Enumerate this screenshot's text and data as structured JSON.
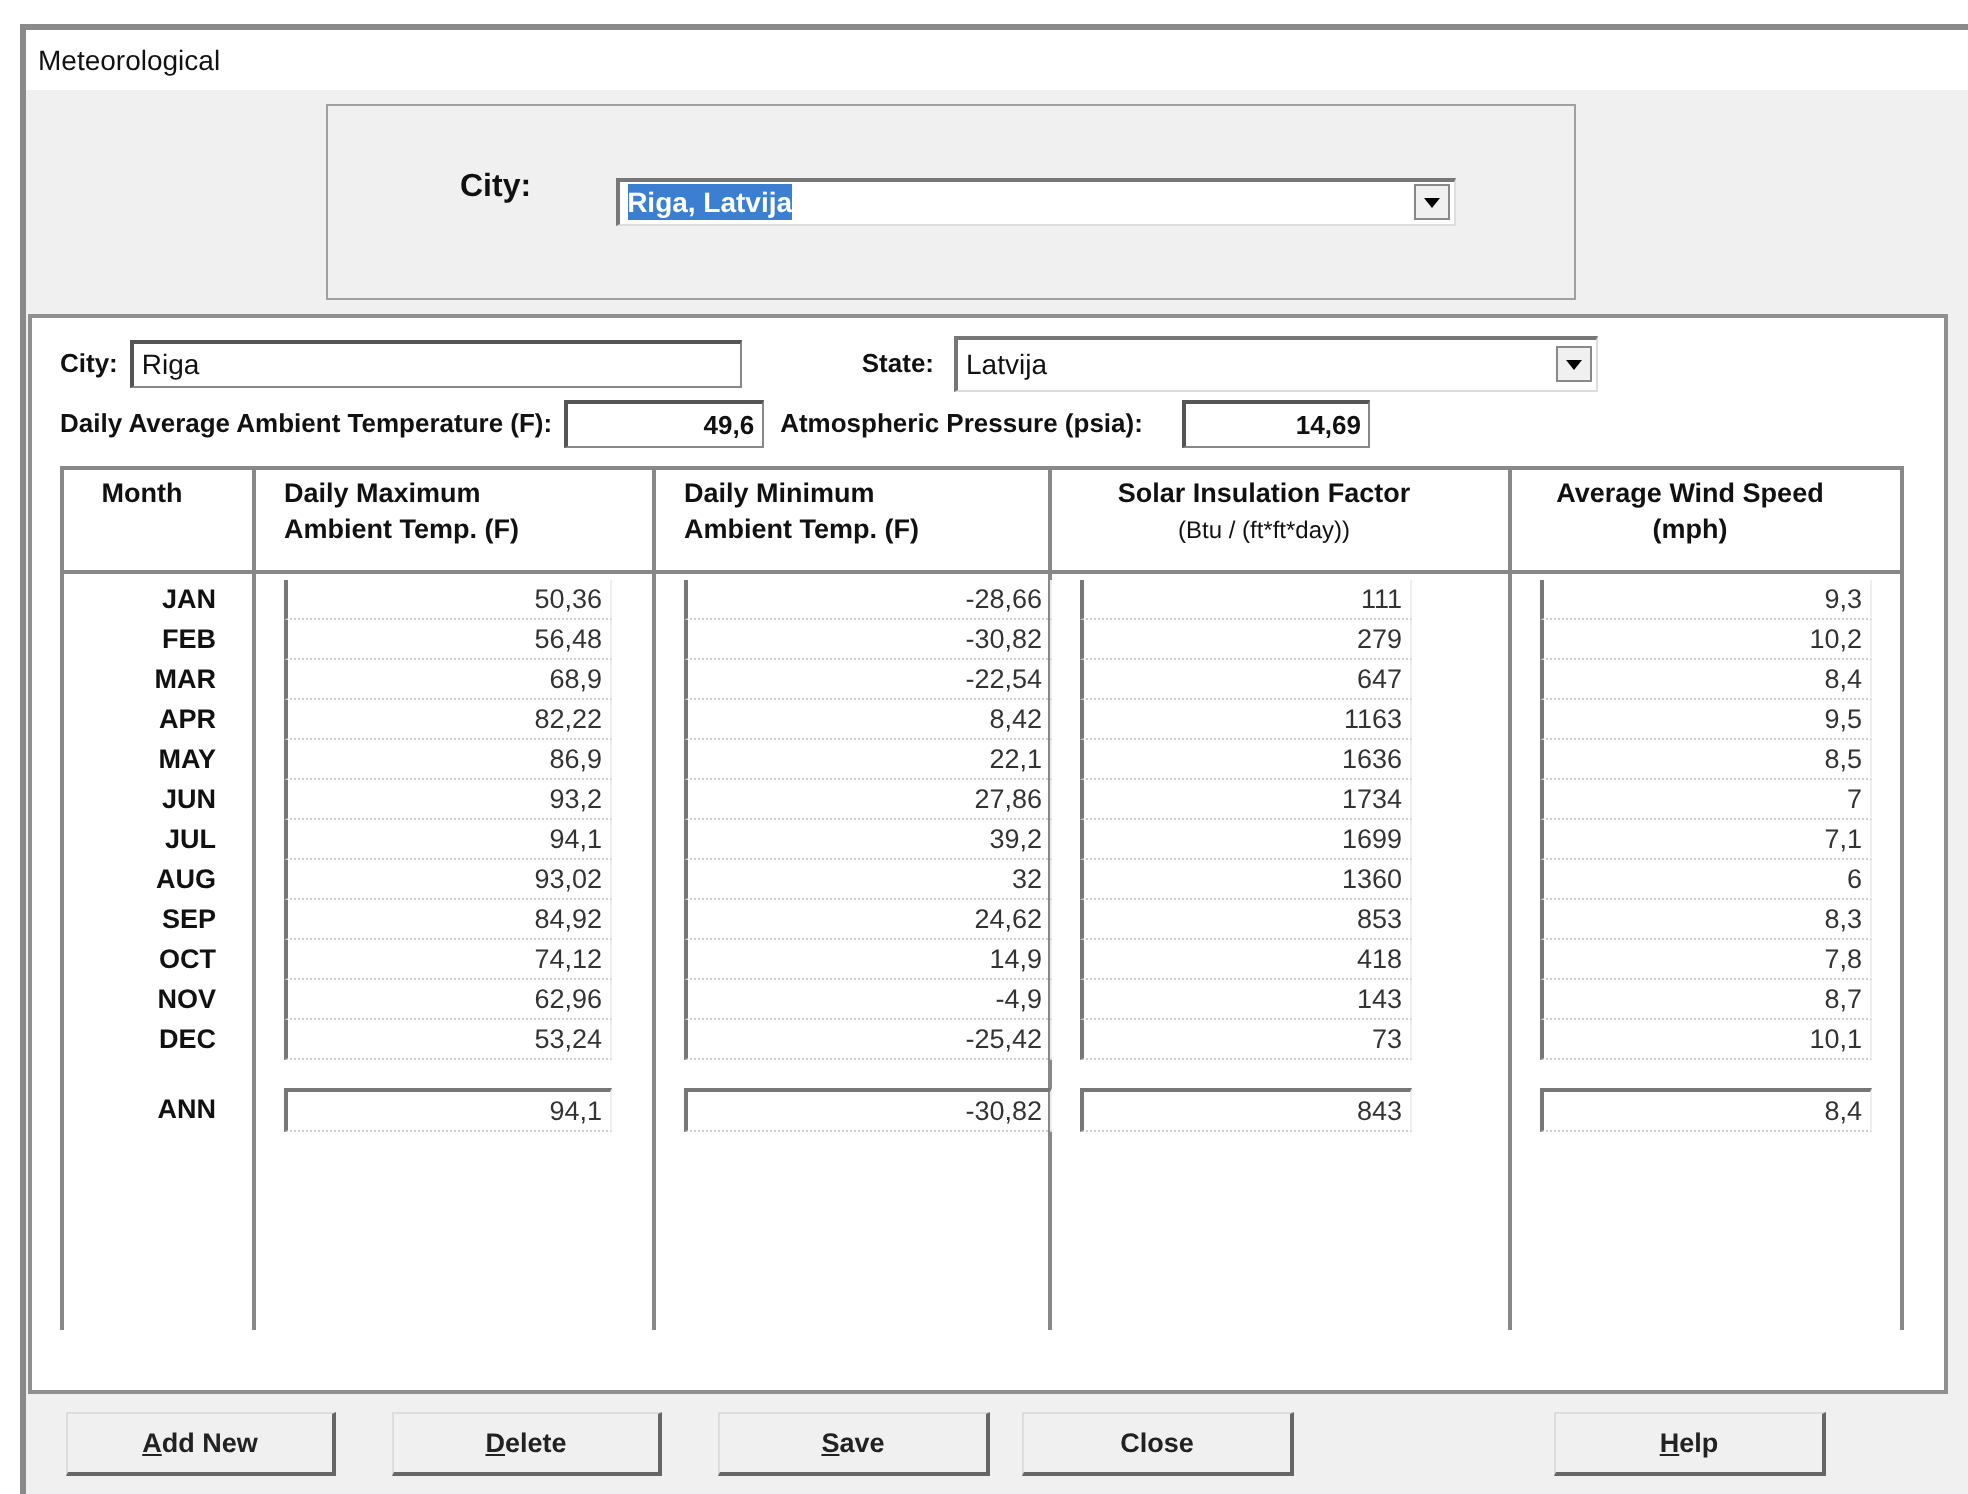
{
  "window": {
    "title": "Meteorological"
  },
  "city_select": {
    "label": "City:",
    "value": "Riga, Latvija"
  },
  "details": {
    "city_label": "City:",
    "city_value": "Riga",
    "state_label": "State:",
    "state_value": "Latvija",
    "avg_temp_label": "Daily Average Ambient Temperature (F):",
    "avg_temp_value": "49,6",
    "pressure_label": "Atmospheric Pressure (psia):",
    "pressure_value": "14,69"
  },
  "table": {
    "columns": [
      {
        "title": "Month"
      },
      {
        "title": "Daily Maximum Ambient Temp. (F)"
      },
      {
        "title": "Daily Minimum Ambient Temp. (F)"
      },
      {
        "title": "Solar Insulation Factor",
        "subtitle": "(Btu / (ft*ft*day))"
      },
      {
        "title": "Average Wind Speed (mph)"
      }
    ],
    "rows": [
      {
        "month": "JAN",
        "values": [
          "50,36",
          "-28,66",
          "111",
          "9,3"
        ]
      },
      {
        "month": "FEB",
        "values": [
          "56,48",
          "-30,82",
          "279",
          "10,2"
        ]
      },
      {
        "month": "MAR",
        "values": [
          "68,9",
          "-22,54",
          "647",
          "8,4"
        ]
      },
      {
        "month": "APR",
        "values": [
          "82,22",
          "8,42",
          "1163",
          "9,5"
        ]
      },
      {
        "month": "MAY",
        "values": [
          "86,9",
          "22,1",
          "1636",
          "8,5"
        ]
      },
      {
        "month": "JUN",
        "values": [
          "93,2",
          "27,86",
          "1734",
          "7"
        ]
      },
      {
        "month": "JUL",
        "values": [
          "94,1",
          "39,2",
          "1699",
          "7,1"
        ]
      },
      {
        "month": "AUG",
        "values": [
          "93,02",
          "32",
          "1360",
          "6"
        ]
      },
      {
        "month": "SEP",
        "values": [
          "84,92",
          "24,62",
          "853",
          "8,3"
        ]
      },
      {
        "month": "OCT",
        "values": [
          "74,12",
          "14,9",
          "418",
          "7,8"
        ]
      },
      {
        "month": "NOV",
        "values": [
          "62,96",
          "-4,9",
          "143",
          "8,7"
        ]
      },
      {
        "month": "DEC",
        "values": [
          "53,24",
          "-25,42",
          "73",
          "10,1"
        ]
      }
    ],
    "annual": {
      "month": "ANN",
      "values": [
        "94,1",
        "-30,82",
        "843",
        "8,4"
      ]
    }
  },
  "buttons": [
    {
      "access_key": "A",
      "label_rest": "dd New"
    },
    {
      "access_key": "D",
      "label_rest": "elete"
    },
    {
      "access_key": "S",
      "label_rest": "ave"
    },
    {
      "label_rest": "Close"
    },
    {
      "access_key": "H",
      "label_rest": "elp"
    }
  ]
}
